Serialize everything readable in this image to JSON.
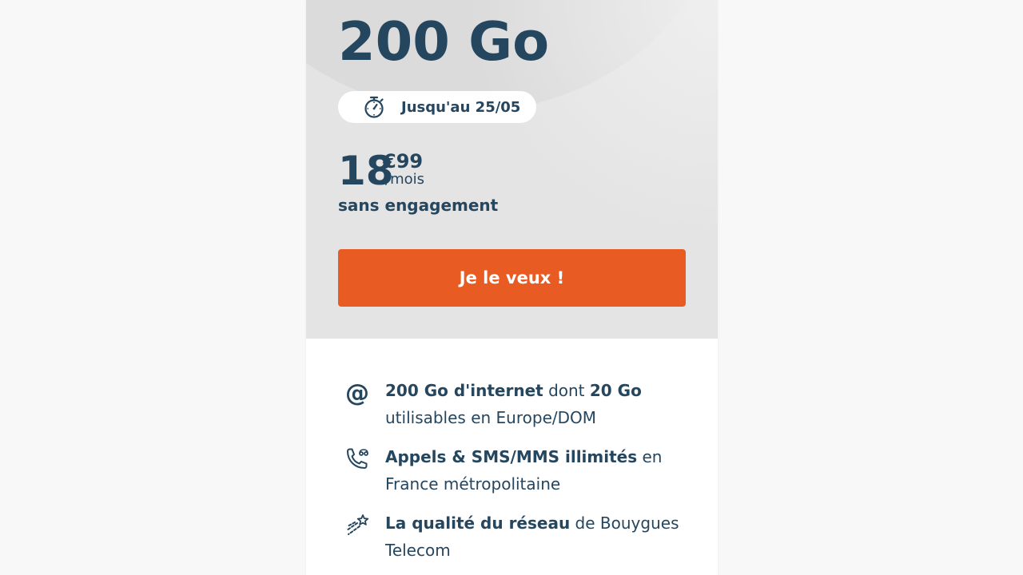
{
  "offer": {
    "data_amount": "200 Go",
    "promo": {
      "icon": "stopwatch-icon",
      "label": "Jusqu'au 25/05"
    },
    "price": {
      "euros": "18",
      "cents": "€99",
      "period": "/mois"
    },
    "commitment": "sans engagement",
    "cta_label": "Je le veux !"
  },
  "features": [
    {
      "icon": "at-icon",
      "icon_glyph": "@",
      "strong_1": "200 Go d'internet",
      "text_1": " dont ",
      "strong_2": "20 Go",
      "text_2": " utilisables en Europe/DOM"
    },
    {
      "icon": "phone-sms-icon",
      "strong_1": "Appels & SMS/MMS illimités",
      "text_1": " en France métropolitaine"
    },
    {
      "icon": "shooting-star-icon",
      "strong_1": "La qualité du réseau",
      "text_1": " de Bouygues Telecom"
    }
  ],
  "colors": {
    "primary_text": "#25465f",
    "cta_background": "#e85b22",
    "cta_text": "#ffffff",
    "hero_background": "#e4e4e4",
    "page_background": "#f8f8f8"
  }
}
